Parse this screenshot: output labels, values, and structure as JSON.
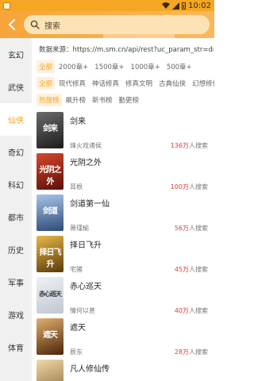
{
  "status_bar": {
    "time": "10:02"
  },
  "header": {
    "search_placeholder": "搜索"
  },
  "sidebar": {
    "items": [
      {
        "label": "玄幻"
      },
      {
        "label": "武侠"
      },
      {
        "label": "仙侠"
      },
      {
        "label": "奇幻"
      },
      {
        "label": "科幻"
      },
      {
        "label": "都市"
      },
      {
        "label": "历史"
      },
      {
        "label": "军事"
      },
      {
        "label": "游戏"
      },
      {
        "label": "体育"
      }
    ],
    "active": "仙侠"
  },
  "main": {
    "source": "数据来源：https://m.sm.cn/api/rest?uc_param_str=dnntn...",
    "word_filters": [
      "全部",
      "2000章+",
      "1500章+",
      "1000章+",
      "500章+"
    ],
    "category_filters": [
      "全部",
      "现代修真",
      "神话修真",
      "修真文明",
      "古典仙侠",
      "幻想修仙"
    ],
    "rank_filters": [
      "热搜榜",
      "飙升榜",
      "新书榜",
      "勤更榜"
    ],
    "books": [
      {
        "title": "剑来",
        "author": "烽火戏诸侯",
        "hot_num": "136万",
        "hot_suffix": "人搜索",
        "cover_text": "剑来",
        "cover_color": "#3a3a3a"
      },
      {
        "title": "光阴之外",
        "author": "耳根",
        "hot_num": "100万",
        "hot_suffix": "人搜索",
        "cover_text": "光阴之外",
        "cover_color": "#8a1f14"
      },
      {
        "title": "剑道第一仙",
        "author": "萧瑾瑜",
        "hot_num": "56万",
        "hot_suffix": "人搜索",
        "cover_text": "剑道",
        "cover_color": "#3c5a86"
      },
      {
        "title": "择日飞升",
        "author": "宅猪",
        "hot_num": "45万",
        "hot_suffix": "人搜索",
        "cover_text": "择日飞升",
        "cover_color": "#b07a1a"
      },
      {
        "title": "赤心巡天",
        "author": "情何以甚",
        "hot_num": "40万",
        "hot_suffix": "人搜索",
        "cover_text": "赤心巡天",
        "cover_color": "#d8dde4"
      },
      {
        "title": "遮天",
        "author": "辰东",
        "hot_num": "28万",
        "hot_suffix": "人搜索",
        "cover_text": "遮天",
        "cover_color": "#7a4a22"
      },
      {
        "title": "凡人修仙传",
        "author": "",
        "hot_num": "",
        "hot_suffix": "",
        "cover_text": "",
        "cover_color": "#c9a36a"
      }
    ]
  }
}
